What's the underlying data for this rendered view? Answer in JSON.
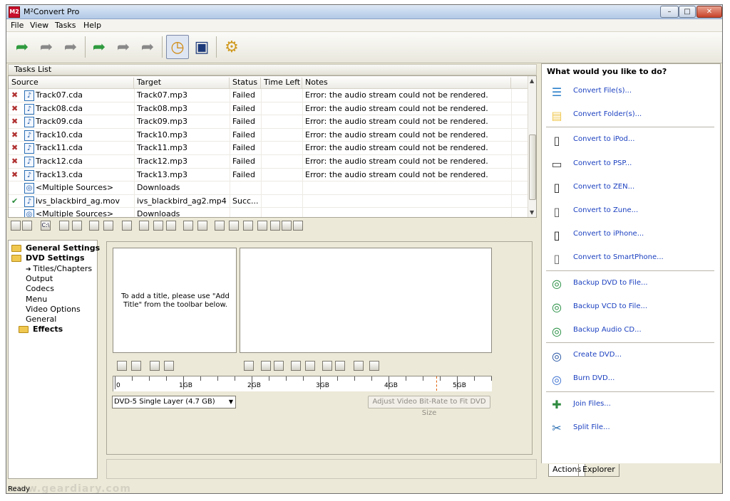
{
  "window": {
    "title": "M²Convert Pro",
    "app_icon_label": "M2",
    "controls": {
      "minimize": "–",
      "maximize": "□",
      "close": "✕"
    }
  },
  "menu": [
    "File",
    "View",
    "Tasks",
    "Help"
  ],
  "toolbar": {
    "icons": [
      "convert-all-icon",
      "convert-selected-icon",
      "convert-file-icon",
      "convert-batch-icon",
      "convert-settings-icon",
      "convert-stop-icon",
      "scheduler-clock-icon",
      "monitor-icon",
      "tools-icon"
    ]
  },
  "tasks": {
    "panel_title": "Tasks List",
    "columns": [
      "Source",
      "Target",
      "Status",
      "Time Left",
      "Notes"
    ],
    "rows": [
      {
        "source": "Track07.cda",
        "target": "Track07.mp3",
        "status": "Failed",
        "time_left": "",
        "notes": "Error: the audio stream could not be rendered.",
        "kind": "failed"
      },
      {
        "source": "Track08.cda",
        "target": "Track08.mp3",
        "status": "Failed",
        "time_left": "",
        "notes": "Error: the audio stream could not be rendered.",
        "kind": "failed"
      },
      {
        "source": "Track09.cda",
        "target": "Track09.mp3",
        "status": "Failed",
        "time_left": "",
        "notes": "Error: the audio stream could not be rendered.",
        "kind": "failed"
      },
      {
        "source": "Track10.cda",
        "target": "Track10.mp3",
        "status": "Failed",
        "time_left": "",
        "notes": "Error: the audio stream could not be rendered.",
        "kind": "failed"
      },
      {
        "source": "Track11.cda",
        "target": "Track11.mp3",
        "status": "Failed",
        "time_left": "",
        "notes": "Error: the audio stream could not be rendered.",
        "kind": "failed"
      },
      {
        "source": "Track12.cda",
        "target": "Track12.mp3",
        "status": "Failed",
        "time_left": "",
        "notes": "Error: the audio stream could not be rendered.",
        "kind": "failed"
      },
      {
        "source": "Track13.cda",
        "target": "Track13.mp3",
        "status": "Failed",
        "time_left": "",
        "notes": "Error: the audio stream could not be rendered.",
        "kind": "failed"
      },
      {
        "source": "<Multiple Sources>",
        "target": "Downloads",
        "status": "",
        "time_left": "",
        "notes": "",
        "kind": "multi"
      },
      {
        "source": "ivs_blackbird_ag.mov",
        "target": "ivs_blackbird_ag2.mp4",
        "status": "Succ...",
        "time_left": "",
        "notes": "",
        "kind": "success"
      },
      {
        "source": "<Multiple Sources>",
        "target": "Downloads",
        "status": "",
        "time_left": "",
        "notes": "",
        "kind": "multi"
      }
    ]
  },
  "task_toolbar_labels": [
    "",
    "",
    "C:\\",
    "",
    "",
    "",
    "",
    "",
    "",
    "",
    "",
    "",
    "",
    "",
    "",
    "",
    "",
    "",
    "",
    ""
  ],
  "settings_tree": {
    "items": [
      {
        "label": "General Settings",
        "bold": true,
        "folder": true,
        "indent": 0
      },
      {
        "label": "DVD Settings",
        "bold": true,
        "folder": true,
        "indent": 0
      },
      {
        "label": "Titles/Chapters",
        "bold": false,
        "folder": false,
        "indent": 2,
        "selected": true
      },
      {
        "label": "Output",
        "bold": false,
        "folder": false,
        "indent": 2
      },
      {
        "label": "Codecs",
        "bold": false,
        "folder": false,
        "indent": 2
      },
      {
        "label": "Menu",
        "bold": false,
        "folder": false,
        "indent": 2
      },
      {
        "label": "Video Options",
        "bold": false,
        "folder": false,
        "indent": 2
      },
      {
        "label": "General",
        "bold": false,
        "folder": false,
        "indent": 2
      },
      {
        "label": "Effects",
        "bold": true,
        "folder": true,
        "indent": 1
      }
    ]
  },
  "dvd": {
    "empty_titles_msg": "To add a title, please use \"Add Title\" from the toolbar below.",
    "ruler_labels": [
      "0",
      "1GB",
      "2GB",
      "3GB",
      "4GB",
      "5GB"
    ],
    "disc_type": "DVD-5 Single Layer (4.7 GB)",
    "fit_button": "Adjust Video Bit-Rate to Fit DVD Size"
  },
  "actions": {
    "title": "What would you like to do?",
    "items": [
      {
        "label": "Convert File(s)...",
        "icon": "convert-file-icon",
        "color": "#2a7fc9",
        "glyph": "☰"
      },
      {
        "label": "Convert Folder(s)...",
        "icon": "folder-icon",
        "color": "#f0c850",
        "glyph": "▤"
      },
      {
        "label": "Convert to iPod...",
        "icon": "ipod-icon",
        "color": "#333",
        "glyph": "▯"
      },
      {
        "label": "Convert to PSP...",
        "icon": "psp-icon",
        "color": "#444",
        "glyph": "▭"
      },
      {
        "label": "Convert to ZEN...",
        "icon": "zen-icon",
        "color": "#222",
        "glyph": "▯"
      },
      {
        "label": "Convert to Zune...",
        "icon": "zune-icon",
        "color": "#555",
        "glyph": "▯"
      },
      {
        "label": "Convert to iPhone...",
        "icon": "iphone-icon",
        "color": "#111",
        "glyph": "▯"
      },
      {
        "label": "Convert to SmartPhone...",
        "icon": "smartphone-icon",
        "color": "#666",
        "glyph": "▯"
      },
      {
        "label": "Backup DVD to File...",
        "icon": "dvd-backup-icon",
        "color": "#1d8a3a",
        "glyph": "◎"
      },
      {
        "label": "Backup VCD to File...",
        "icon": "vcd-backup-icon",
        "color": "#1d8a3a",
        "glyph": "◎"
      },
      {
        "label": "Backup Audio CD...",
        "icon": "cd-backup-icon",
        "color": "#1d8a3a",
        "glyph": "◎"
      },
      {
        "label": "Create DVD...",
        "icon": "create-dvd-icon",
        "color": "#1f4fa0",
        "glyph": "◎"
      },
      {
        "label": "Burn DVD...",
        "icon": "burn-dvd-icon",
        "color": "#3a6fd0",
        "glyph": "◎"
      },
      {
        "label": "Join Files...",
        "icon": "join-files-icon",
        "color": "#2e8a3f",
        "glyph": "✚"
      },
      {
        "label": "Split File...",
        "icon": "split-file-icon",
        "color": "#2a6eb3",
        "glyph": "✂"
      }
    ],
    "tabs": [
      "Actions",
      "Explorer"
    ]
  },
  "status": {
    "text": "Ready"
  },
  "watermark": "www.geardiary.com"
}
